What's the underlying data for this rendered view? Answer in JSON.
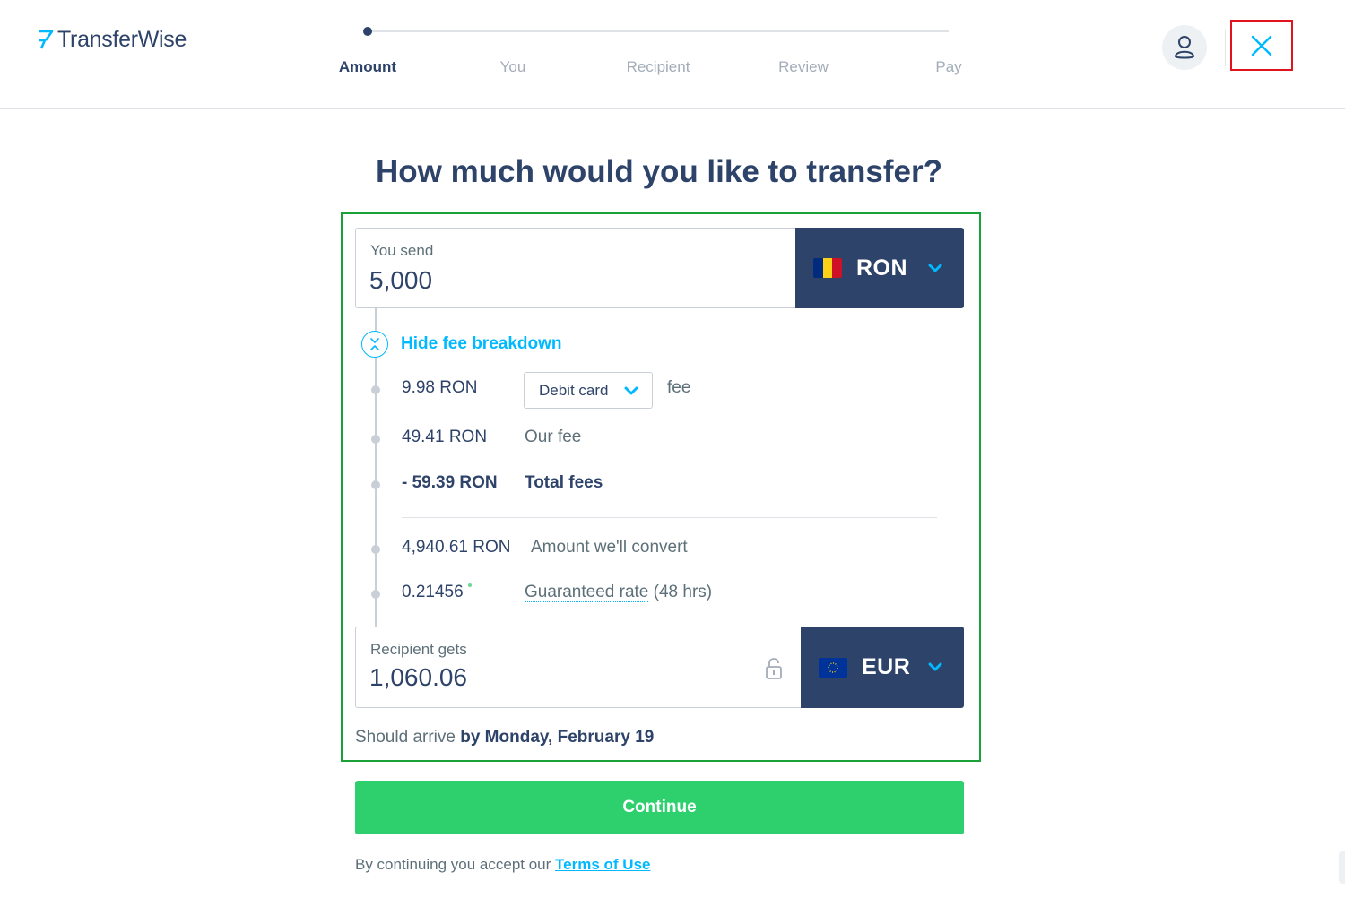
{
  "brand": {
    "name": "TransferWise"
  },
  "steps": [
    {
      "label": "Amount",
      "active": true
    },
    {
      "label": "You",
      "active": false
    },
    {
      "label": "Recipient",
      "active": false
    },
    {
      "label": "Review",
      "active": false
    },
    {
      "label": "Pay",
      "active": false
    }
  ],
  "header": {
    "profile_icon": "user-icon",
    "close_icon": "close-icon"
  },
  "main": {
    "title": "How much would you like to transfer?",
    "send": {
      "label": "You send",
      "value": "5,000",
      "currency": "RON",
      "flag": "romania-flag"
    },
    "fee_toggle": "Hide fee breakdown",
    "fees": [
      {
        "amount": "9.98 RON",
        "desc": "fee",
        "method": "Debit card"
      },
      {
        "amount": "49.41 RON",
        "desc": "Our fee"
      },
      {
        "amount": "- 59.39 RON",
        "desc": "Total fees"
      },
      {
        "amount": "4,940.61 RON",
        "desc": "Amount we'll convert"
      },
      {
        "amount": "0.21456",
        "desc_link": "Guaranteed rate",
        "desc_suffix": " (48 hrs)"
      }
    ],
    "receive": {
      "label": "Recipient gets",
      "value": "1,060.06",
      "currency": "EUR",
      "flag": "eu-flag"
    },
    "arrival": {
      "prefix": "Should arrive ",
      "date": "by Monday, February 19"
    },
    "continue_label": "Continue",
    "terms": {
      "prefix": "By continuing you accept our ",
      "link": "Terms of Use"
    }
  },
  "colors": {
    "accent": "#00b9ff",
    "navy": "#2e4369",
    "green": "#2ed06e"
  }
}
